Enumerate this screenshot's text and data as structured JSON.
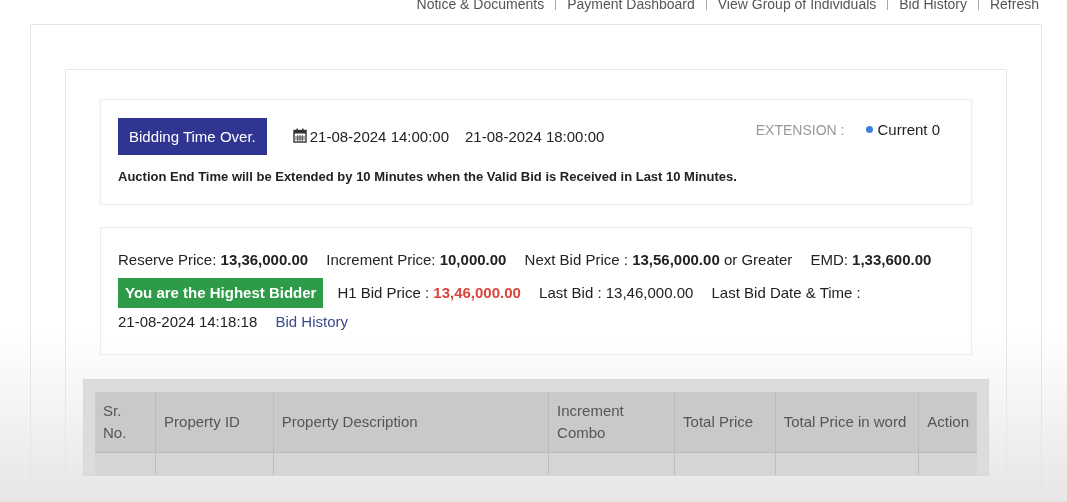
{
  "top_links": [
    {
      "label": "Notice & Documents"
    },
    {
      "label": "Payment Dashboard"
    },
    {
      "label": "View Group of Individuals"
    },
    {
      "label": "Bid History"
    },
    {
      "label": "Refresh"
    }
  ],
  "timer": {
    "status": "Bidding Time Over.",
    "start": "21-08-2024 14:00:00",
    "end": "21-08-2024 18:00:00",
    "extension_label": "EXTENSION :",
    "extension_value": "Current 0",
    "note": "Auction End Time will be Extended by 10 Minutes when the Valid Bid is Received in Last 10 Minutes."
  },
  "prices": [
    {
      "text": "Reserve Price: **13,36,000.00**"
    },
    {
      "text": "Increment Price: **10,000.00**"
    },
    {
      "text": "Next Bid Price : **13,56,000.00** or Greater"
    },
    {
      "text": "EMD: **1,33,600.00**"
    }
  ],
  "bid_status": {
    "badge": "You are the Highest Bidder",
    "h1_label": "H1 Bid Price :",
    "h1_value": "13,46,000.00",
    "last_bid": "Last Bid : 13,46,000.00",
    "last_bid_time_label": "Last Bid Date & Time :",
    "last_bid_time": "21-08-2024 14:18:18",
    "history_link": "Bid History"
  },
  "table": {
    "columns": [
      "Sr. No.",
      "Property ID",
      "Property Description",
      "Increment Combo",
      "Total Price",
      "Total Price in word",
      "Action"
    ]
  }
}
